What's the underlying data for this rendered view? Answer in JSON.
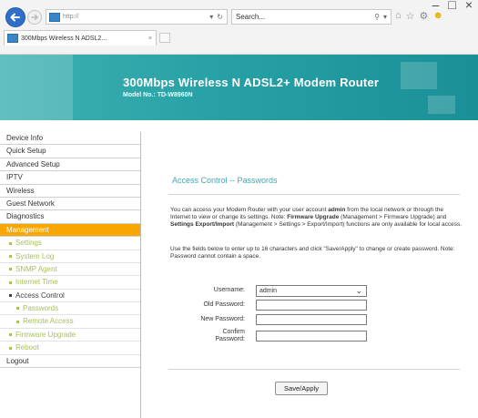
{
  "browser": {
    "address": "http://",
    "search": "Search...",
    "tab_title": "300Mbps Wireless N ADSL2...",
    "tab_close": "×",
    "window_controls": [
      "–",
      "□",
      "×"
    ]
  },
  "header": {
    "title": "300Mbps Wireless N ADSL2+ Modem Router",
    "model": "Model No.: TD-W8960N",
    "bg_color": "#27a1a6"
  },
  "sidebar": {
    "items": [
      {
        "label": "Device Info",
        "level": 0,
        "active": false
      },
      {
        "label": "Quick Setup",
        "level": 0,
        "active": false
      },
      {
        "label": "Advanced Setup",
        "level": 0,
        "active": false
      },
      {
        "label": "IPTV",
        "level": 0,
        "active": false
      },
      {
        "label": "Wireless",
        "level": 0,
        "active": false
      },
      {
        "label": "Guest Network",
        "level": 0,
        "active": false
      },
      {
        "label": "Diagnostics",
        "level": 0,
        "active": false
      },
      {
        "label": "Management",
        "level": 0,
        "active": true
      },
      {
        "label": "Settings",
        "level": 1
      },
      {
        "label": "System Log",
        "level": 1
      },
      {
        "label": "SNMP Agent",
        "level": 1
      },
      {
        "label": "Internet Time",
        "level": 1
      },
      {
        "label": "Access Control",
        "level": 1,
        "current": true
      },
      {
        "label": "Passwords",
        "level": 2
      },
      {
        "label": "Remote Access",
        "level": 2
      },
      {
        "label": "Firmware Upgrade",
        "level": 1
      },
      {
        "label": "Reboot",
        "level": 1
      },
      {
        "label": "Logout",
        "level": 0,
        "active": false
      }
    ],
    "active_color": "#f7a700"
  },
  "main": {
    "title": "Access Control -- Passwords",
    "para1": {
      "t1": "You can access your Modem Router with your user account ",
      "b1": "admin",
      "t2": " from the local network or through the Internet to view or change its settings. Note: ",
      "b2": "Firmware Upgrade",
      "t3": " (Management > Firmware Upgrade) and ",
      "b3": "Settings Export/Import",
      "t4": " (Management > Settings > Export/Import) functions are only available for local access."
    },
    "para2": "Use the fields below to enter up to 16 characters and click \"Save/Apply\" to change or create password. Note: Password cannot contain a space.",
    "form": {
      "username_label": "Username:",
      "username_value": "admin",
      "old_password_label": "Old Password:",
      "new_password_label": "New Password:",
      "confirm_label_1": "Confirm",
      "confirm_label_2": "Password:",
      "save_button": "Save/Apply"
    }
  }
}
